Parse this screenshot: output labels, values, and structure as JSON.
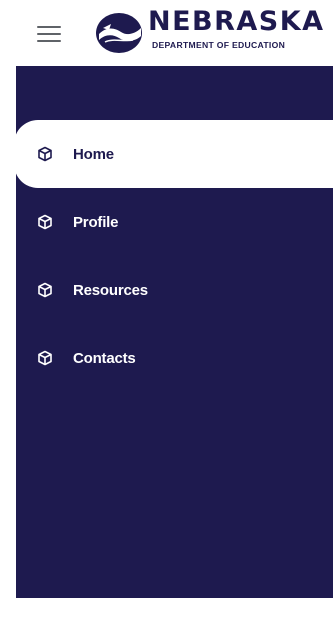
{
  "header": {
    "menu_icon": "hamburger-menu-icon",
    "logo": {
      "title": "NEBRASKA",
      "subtitle": "DEPARTMENT OF EDUCATION"
    }
  },
  "sidebar": {
    "background": "#1e1a4f",
    "items": [
      {
        "label": "Home",
        "icon": "cube-icon",
        "active": true
      },
      {
        "label": "Profile",
        "icon": "cube-icon",
        "active": false
      },
      {
        "label": "Resources",
        "icon": "cube-icon",
        "active": false
      },
      {
        "label": "Contacts",
        "icon": "cube-icon",
        "active": false
      }
    ]
  }
}
